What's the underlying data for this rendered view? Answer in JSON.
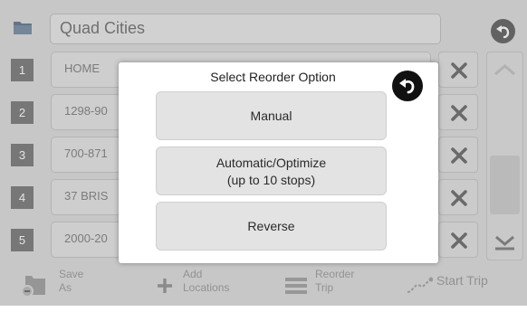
{
  "header": {
    "trip_name": "Quad Cities"
  },
  "stops": [
    {
      "number": "1",
      "name": "HOME"
    },
    {
      "number": "2",
      "name": "1298-90"
    },
    {
      "number": "3",
      "name": "700-871"
    },
    {
      "number": "4",
      "name": "37 BRIS"
    },
    {
      "number": "5",
      "name": "2000-20"
    }
  ],
  "toolbar": {
    "save": [
      "Save",
      "As"
    ],
    "add": [
      "Add",
      "Locations"
    ],
    "reorder": [
      "Reorder",
      "Trip"
    ],
    "start": "Start Trip"
  },
  "dialog": {
    "title": "Select Reorder Option",
    "options": {
      "manual": "Manual",
      "automatic_line1": "Automatic/Optimize",
      "automatic_line2": "(up to 10 stops)",
      "reverse": "Reverse"
    }
  },
  "icons": {
    "back": "back-arrow-icon",
    "delete": "x-icon",
    "folder": "folder-icon"
  }
}
